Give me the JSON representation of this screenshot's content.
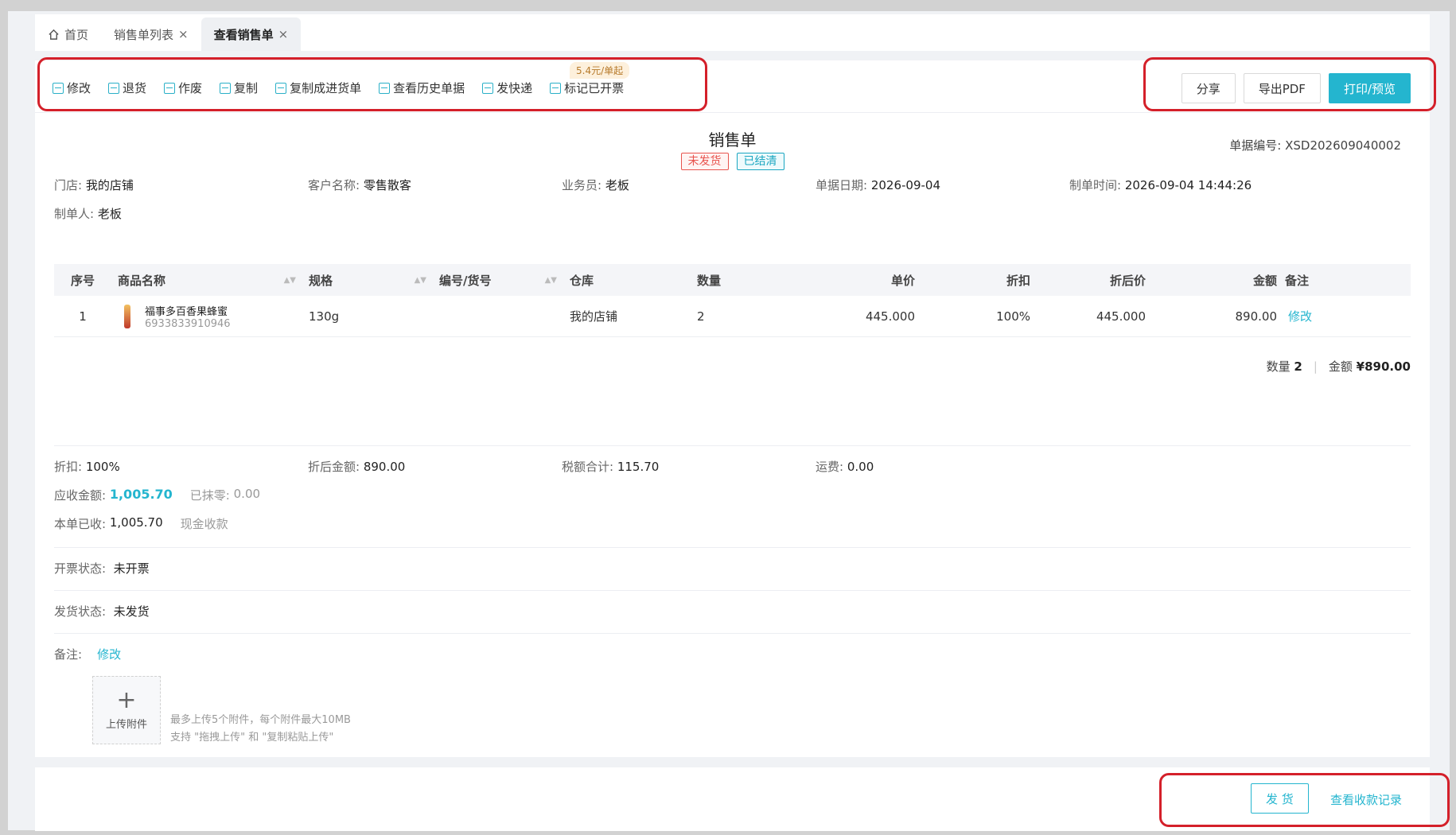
{
  "tabs": [
    {
      "label": "首页",
      "closable": false,
      "active": false
    },
    {
      "label": "销售单列表",
      "closable": true,
      "active": false
    },
    {
      "label": "查看销售单",
      "closable": true,
      "active": true
    }
  ],
  "tab_close": "×",
  "toolbar": {
    "actions": [
      "修改",
      "退货",
      "作废",
      "复制",
      "复制成进货单",
      "查看历史单据",
      "发快递",
      "标记已开票"
    ],
    "express_badge": "5.4元/单起",
    "share": "分享",
    "export_pdf": "导出PDF",
    "print_preview": "打印/预览"
  },
  "doc": {
    "title": "销售单",
    "status_tags": [
      "未发货",
      "已结清"
    ],
    "doc_no_label": "单据编号:",
    "doc_no": "XSD202609040002"
  },
  "info": {
    "store_label": "门店:",
    "store": "我的店铺",
    "customer_label": "客户名称:",
    "customer": "零售散客",
    "salesman_label": "业务员:",
    "salesman": "老板",
    "date_label": "单据日期:",
    "date": "2026-09-04",
    "created_label": "制单时间:",
    "created": "2026-09-04 14:44:26",
    "creator_label": "制单人:",
    "creator": "老板"
  },
  "table": {
    "headers": [
      "序号",
      "商品名称",
      "规格",
      "编号/货号",
      "仓库",
      "数量",
      "单价",
      "折扣",
      "折后价",
      "金额",
      "备注"
    ],
    "rows": [
      {
        "index": "1",
        "name": "福事多百香果蜂蜜",
        "barcode": "6933833910946",
        "spec": "130g",
        "code": "",
        "warehouse": "我的店铺",
        "qty": "2",
        "price": "445.000",
        "discount": "100%",
        "disc_price": "445.000",
        "amount": "890.00",
        "remark_link": "修改"
      }
    ]
  },
  "summary": {
    "qty_label": "数量",
    "qty": "2",
    "amount_label": "金额",
    "amount": "¥890.00"
  },
  "totals": {
    "discount_label": "折扣:",
    "discount": "100%",
    "after_disc_label": "折后金额:",
    "after_disc": "890.00",
    "tax_label": "税额合计:",
    "tax": "115.70",
    "freight_label": "运费:",
    "freight": "0.00",
    "receivable_label": "应收金额:",
    "receivable": "1,005.70",
    "writeoff_label": "已抹零:",
    "writeoff": "0.00",
    "received_label": "本单已收:",
    "received": "1,005.70",
    "pay_method": "现金收款"
  },
  "invoice": {
    "label": "开票状态:",
    "value": "未开票"
  },
  "shipping": {
    "label": "发货状态:",
    "value": "未发货"
  },
  "remark": {
    "label": "备注:",
    "edit": "修改"
  },
  "upload": {
    "label": "上传附件",
    "hint1": "最多上传5个附件，每个附件最大10MB",
    "hint2": "支持 \"拖拽上传\" 和 \"复制粘贴上传\""
  },
  "bottom": {
    "ship": "发 货",
    "payments": "查看收款记录"
  },
  "colors": {
    "accent": "#24b5cf",
    "highlight": "#d4202a",
    "red_tag": "#e8544e"
  }
}
